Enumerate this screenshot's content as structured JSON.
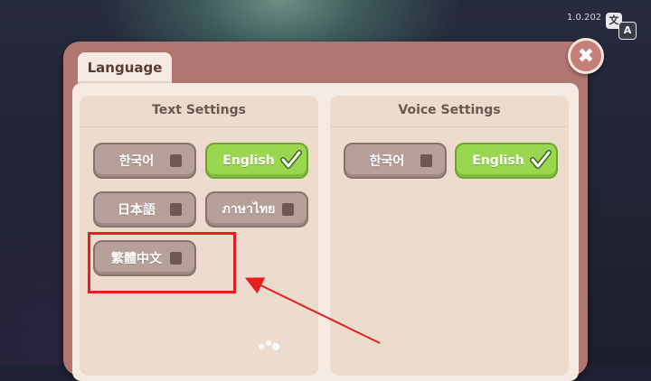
{
  "version": "1.0.202",
  "dialog": {
    "tab_label": "Language",
    "close_label": "✖"
  },
  "text_settings": {
    "title": "Text Settings",
    "options": [
      {
        "label": "한국어",
        "selected": false
      },
      {
        "label": "English",
        "selected": true
      },
      {
        "label": "日本語",
        "selected": false
      },
      {
        "label": "ภาษาไทย",
        "selected": false
      },
      {
        "label": "繁體中文",
        "selected": false
      }
    ]
  },
  "voice_settings": {
    "title": "Voice Settings",
    "options": [
      {
        "label": "한국어",
        "selected": false
      },
      {
        "label": "English",
        "selected": true
      }
    ]
  },
  "colors": {
    "selected": "#9bd651",
    "unselected": "#b7a09a",
    "annotation": "#e61e1e"
  }
}
